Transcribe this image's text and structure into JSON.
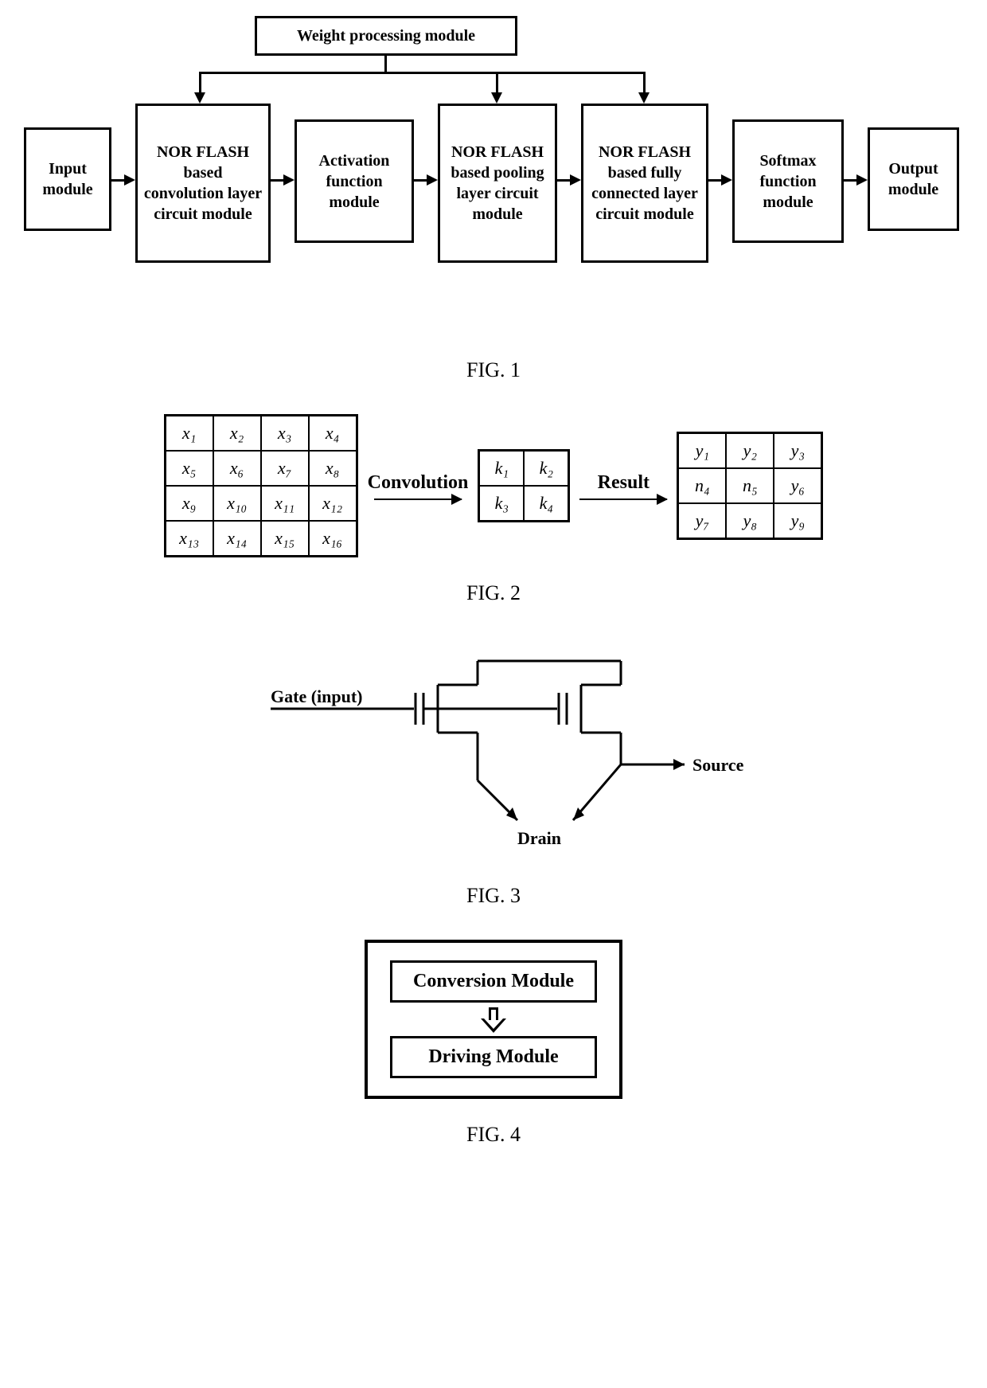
{
  "fig1": {
    "weight": "Weight processing module",
    "input": "Input module",
    "conv": "NOR FLASH based convolution layer circuit module",
    "activation": "Activation function module",
    "pool": "NOR FLASH based pooling layer circuit module",
    "fc": "NOR FLASH based fully connected layer circuit module",
    "softmax": "Softmax function module",
    "output": "Output module",
    "caption": "FIG. 1"
  },
  "fig2": {
    "x": [
      "x₁",
      "x₂",
      "x₃",
      "x₄",
      "x₅",
      "x₆",
      "x₇",
      "x₈",
      "x₉",
      "x₁₀",
      "x₁₁",
      "x₁₂",
      "x₁₃",
      "x₁₄",
      "x₁₅",
      "x₁₆"
    ],
    "k": [
      "k₁",
      "k₂",
      "k₃",
      "k₄"
    ],
    "y": [
      "y₁",
      "y₂",
      "y₃",
      "n₄",
      "n₅",
      "y₆",
      "y₇",
      "y₈",
      "y₉"
    ],
    "labelConv": "Convolution",
    "labelResult": "Result",
    "caption": "FIG. 2"
  },
  "fig3": {
    "gate": "Gate (input)",
    "drain": "Drain",
    "source": "Source",
    "caption": "FIG. 3"
  },
  "fig4": {
    "conv": "Conversion Module",
    "drive": "Driving Module",
    "caption": "FIG. 4"
  }
}
